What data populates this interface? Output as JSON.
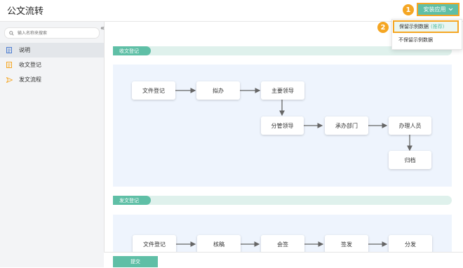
{
  "app": {
    "title": "公文流转"
  },
  "install": {
    "label": "安装应用",
    "step1": "1",
    "step2": "2"
  },
  "dropdown": {
    "item1_label": "保留示例数据",
    "item1_tag": "(推荐)",
    "item2_label": "不保留示例数据"
  },
  "sidebar": {
    "search_placeholder": "输入名称来搜索",
    "collapse_glyph": "«",
    "items": [
      {
        "label": "说明",
        "icon": "doc-icon"
      },
      {
        "label": "收文登记",
        "icon": "form-icon"
      },
      {
        "label": "发文流程",
        "icon": "send-icon"
      }
    ]
  },
  "sections": [
    {
      "title": "收文登记",
      "nodes": [
        "文件登记",
        "拟办",
        "主要领导",
        "分管领导",
        "承办部门",
        "办理人员",
        "归档"
      ]
    },
    {
      "title": "发文登记",
      "nodes": [
        "文件登记",
        "核稿",
        "会签",
        "签发",
        "分发"
      ]
    }
  ],
  "footer": {
    "submit_label": "提交"
  },
  "colors": {
    "accent": "#5fbfa6",
    "highlight": "#f5a623",
    "panel": "#eef4fd"
  }
}
